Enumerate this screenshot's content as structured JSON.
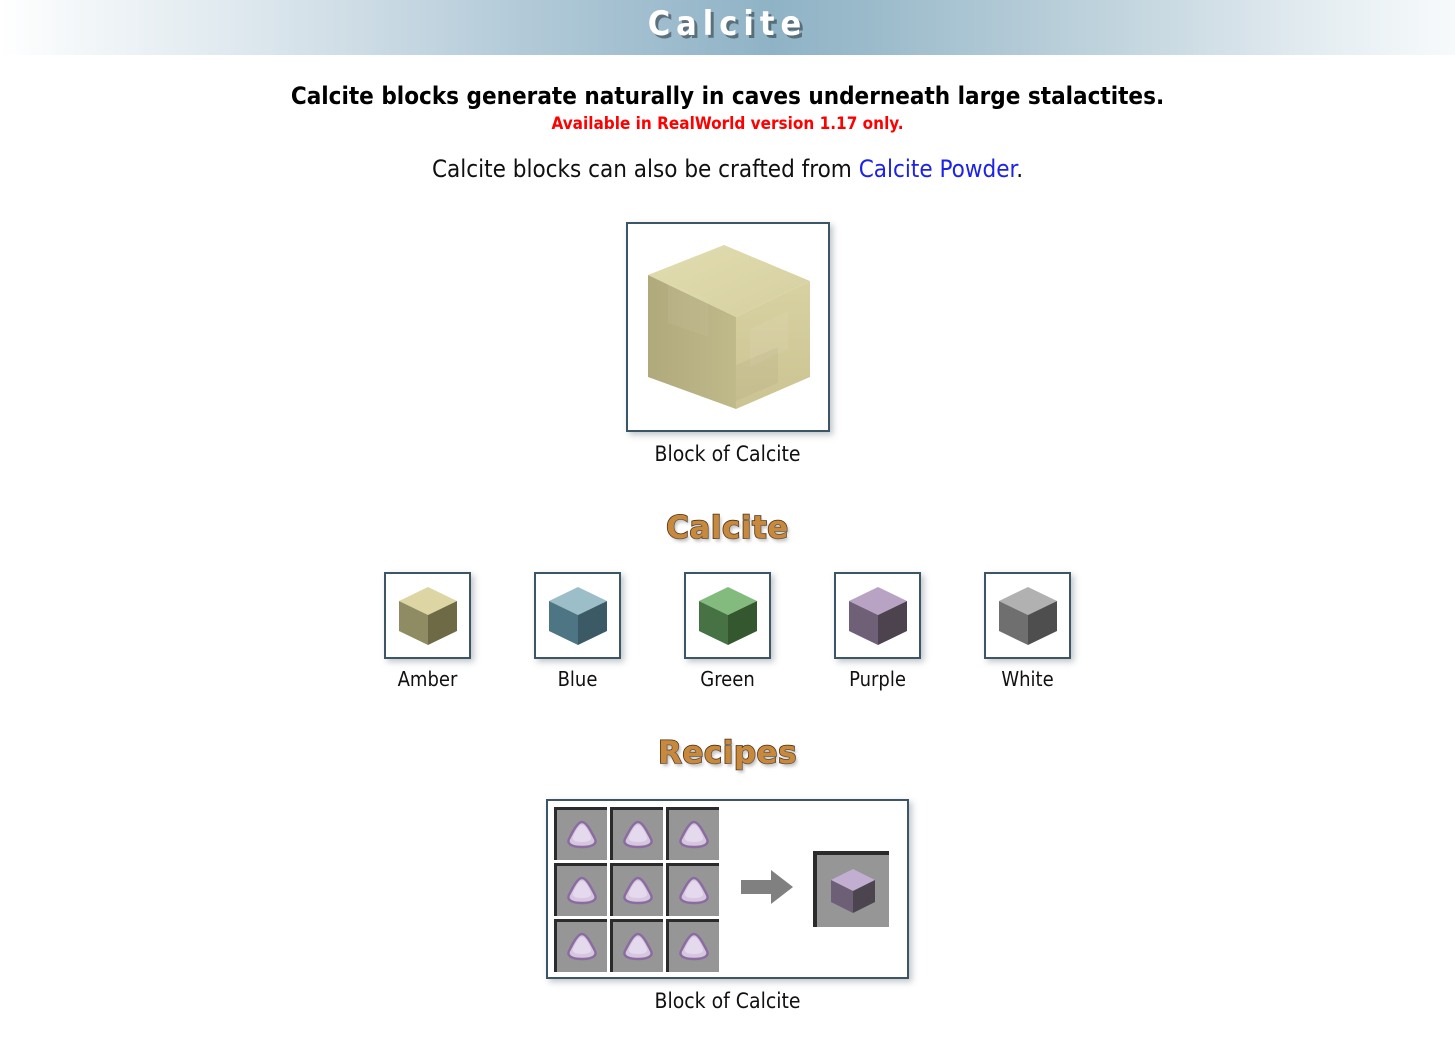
{
  "header": {
    "title": "Calcite"
  },
  "intro": {
    "line1": "Calcite blocks generate naturally in caves underneath large stalactites.",
    "line2": "Available in RealWorld version 1.17 only.",
    "line3_prefix": "Calcite blocks can also be crafted from ",
    "line3_link": "Calcite Powder",
    "line3_suffix": "."
  },
  "main_block": {
    "caption": "Block of Calcite",
    "colors": {
      "top": "#ddd9a8",
      "front": "#d0c898",
      "side": "#b8b183"
    }
  },
  "variants_section": {
    "heading": "Calcite",
    "items": [
      {
        "label": "Amber",
        "top": "#ddd6a4",
        "left": "#8f8b63",
        "right": "#6e6a45"
      },
      {
        "label": "Blue",
        "top": "#9bbec8",
        "left": "#4e7583",
        "right": "#3b5a66"
      },
      {
        "label": "Green",
        "top": "#83bb7e",
        "left": "#477243",
        "right": "#345730"
      },
      {
        "label": "Purple",
        "top": "#b9a3c4",
        "left": "#6f6077",
        "right": "#4c434f"
      },
      {
        "label": "White",
        "top": "#b1b1b1",
        "left": "#6f6f6f",
        "right": "#4e4e4e"
      }
    ]
  },
  "recipes_section": {
    "heading": "Recipes",
    "caption": "Block of Calcite",
    "ingredient_name": "calcite-powder",
    "ingredient_count": 9,
    "ingredient_colors": {
      "fill": "#d6c6e0",
      "outline": "#8a6ca0",
      "highlight": "#efe7f4"
    },
    "arrow_color": "#808080",
    "slot_color": "#969696",
    "output_name": "block-of-calcite-purple",
    "output_colors": {
      "top": "#c2aed0",
      "left": "#6d5f76",
      "right": "#4c444f"
    }
  },
  "theme": {
    "heading_fill": "#c8893d",
    "heading_stroke": "#4a2d12",
    "link_color": "#1c22e8",
    "warning_color": "#ff0000",
    "frame_border": "#3c5666"
  }
}
